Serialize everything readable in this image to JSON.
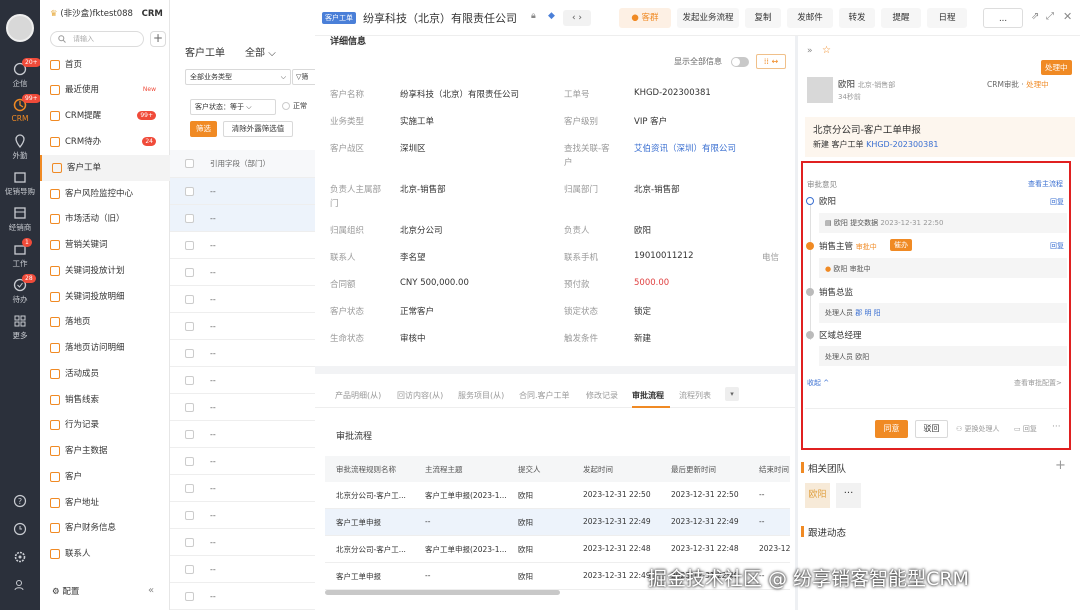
{
  "rail": {
    "items": [
      {
        "icon": "chat-icon",
        "label": "企信",
        "badge": "20+"
      },
      {
        "icon": "crm-icon",
        "label": "CRM",
        "badge": "99+"
      },
      {
        "icon": "location-icon",
        "label": "外勤",
        "badge": ""
      },
      {
        "icon": "box-icon",
        "label": "促销导购",
        "badge": ""
      },
      {
        "icon": "dealer-icon",
        "label": "经销商",
        "badge": ""
      },
      {
        "icon": "work-icon",
        "label": "工作",
        "badge": "1"
      },
      {
        "icon": "todo-icon",
        "label": "待办",
        "badge": "28"
      },
      {
        "icon": "grid-icon",
        "label": "更多",
        "badge": ""
      }
    ]
  },
  "sidebar": {
    "company": "(非沙盒)fktest088",
    "app": "CRM",
    "search_placeholder": "请输入",
    "items": [
      {
        "label": "首页",
        "tag": ""
      },
      {
        "label": "最近使用",
        "tag": "New"
      },
      {
        "label": "CRM提醒",
        "tag": "99+"
      },
      {
        "label": "CRM待办",
        "tag": "24"
      },
      {
        "label": "客户工单",
        "tag": ""
      },
      {
        "label": "客户风险监控中心",
        "tag": ""
      },
      {
        "label": "市场活动（旧）",
        "tag": ""
      },
      {
        "label": "营销关键词",
        "tag": ""
      },
      {
        "label": "关键词投放计划",
        "tag": ""
      },
      {
        "label": "关键词投放明细",
        "tag": ""
      },
      {
        "label": "落地页",
        "tag": ""
      },
      {
        "label": "落地页访问明细",
        "tag": ""
      },
      {
        "label": "活动成员",
        "tag": ""
      },
      {
        "label": "销售线索",
        "tag": ""
      },
      {
        "label": "行为记录",
        "tag": ""
      },
      {
        "label": "客户主数据",
        "tag": ""
      },
      {
        "label": "客户",
        "tag": ""
      },
      {
        "label": "客户地址",
        "tag": ""
      },
      {
        "label": "客户财务信息",
        "tag": ""
      },
      {
        "label": "联系人",
        "tag": ""
      }
    ],
    "config": "配置",
    "collapse": "«"
  },
  "list": {
    "title": "客户工单",
    "scope": "全部",
    "type_select": "全部业务类型",
    "filter_btn": "筛",
    "status_filter": "客户状态：等于",
    "status_option": "正常",
    "btn_filter": "筛选",
    "btn_clear": "清除外露筛选值",
    "column": "引用字段（部门）",
    "rows": [
      "--",
      "--",
      "--",
      "--",
      "--",
      "--",
      "--",
      "--",
      "--",
      "--",
      "--",
      "--",
      "--",
      "--",
      "--",
      "--"
    ]
  },
  "header": {
    "tag": "客户工单",
    "title": "纷享科技（北京）有限责任公司",
    "buttons": [
      "客群",
      "发起业务流程",
      "复制",
      "发邮件",
      "转发",
      "提醒",
      "日程",
      "..."
    ]
  },
  "detail": {
    "section": "详细信息",
    "show_all": "显示全部信息",
    "fields": [
      {
        "l1": "客户名称",
        "v1": "纷享科技（北京）有限责任公司",
        "l2": "工单号",
        "v2": "KHGD-202300381"
      },
      {
        "l1": "业务类型",
        "v1": "实施工单",
        "l2": "客户级别",
        "v2": "VIP 客户"
      },
      {
        "l1": "客户战区",
        "v1": "深圳区",
        "l2": "查找关联-客户",
        "v2": "艾伯资讯（深圳）有限公司"
      },
      {
        "l1": "负责人主属部门",
        "v1": "北京-销售部",
        "l2": "归属部门",
        "v2": "北京-销售部"
      },
      {
        "l1": "归属组织",
        "v1": "北京分公司",
        "l2": "负责人",
        "v2": "欧阳"
      },
      {
        "l1": "联系人",
        "v1": "李名望",
        "l2": "联系手机",
        "v2": "19010011212"
      },
      {
        "l1": "合同额",
        "v1": "CNY 500,000.00",
        "l2": "预付款",
        "v2": "5000.00"
      },
      {
        "l1": "客户状态",
        "v1": "正常客户",
        "l2": "锁定状态",
        "v2": "锁定"
      },
      {
        "l1": "生命状态",
        "v1": "审核中",
        "l2": "触发条件",
        "v2": "新建"
      }
    ],
    "phone_label": "电信",
    "tabs": [
      "产品明细(从)",
      "回访内容(从)",
      "服务项目(从)",
      "合同.客户工单",
      "修改记录",
      "审批流程",
      "流程列表"
    ],
    "active_tab": "审批流程",
    "flow_title": "审批流程",
    "table_headers": [
      "审批流程规则名称",
      "主流程主题",
      "提交人",
      "发起时间",
      "最后更新时间",
      "结束时间"
    ],
    "table_rows": [
      [
        "北京分公司-客户工...",
        "客户工单申报(2023-1...",
        "欧阳",
        "2023-12-31 22:50",
        "2023-12-31 22:50",
        "--"
      ],
      [
        "客户工单申报",
        "--",
        "欧阳",
        "2023-12-31 22:49",
        "2023-12-31 22:49",
        "--"
      ],
      [
        "北京分公司-客户工...",
        "客户工单申报(2023-1...",
        "欧阳",
        "2023-12-31 22:48",
        "2023-12-31 22:48",
        "2023-12"
      ],
      [
        "客户工单申报",
        "--",
        "欧阳",
        "2023-12-31 22:49",
        "2023-12-31 22:49",
        "--"
      ]
    ]
  },
  "approval": {
    "status_badge": "处理中",
    "user": "欧阳",
    "user_dept": "北京-销售部",
    "time_ago": "34秒前",
    "crm_approval": "CRM审批 · ",
    "crm_status": "处理中",
    "card_title": "北京分公司-客户工单申报",
    "card_sub": "新建 客户工单 ",
    "card_link": "KHGD-202300381",
    "opinion": "审批意见",
    "view_flow": "查看主流程",
    "steps": [
      {
        "name": "欧阳",
        "reply": "回复",
        "note_user": "欧阳",
        "note": "提交数据",
        "note_time": "2023-12-31 22:50"
      },
      {
        "name": "销售主管",
        "status": "审批中",
        "urge": "催办",
        "reply": "回复",
        "note_user": "欧阳",
        "note": "审批中"
      },
      {
        "name": "销售总监",
        "handler_label": "处理人员",
        "handler": "郡 明 阳"
      },
      {
        "name": "区域总经理",
        "handler_label": "处理人员",
        "handler": "欧阳"
      }
    ],
    "collapse": "收起 ^",
    "view_config": "查看审批配置>",
    "agree": "同意",
    "reject": "驳回",
    "change_handler": "更换处理人",
    "reply": "回复",
    "more": "···",
    "team_title": "相关团队",
    "team_member": "欧阳",
    "follow_title": "跟进动态"
  },
  "watermark": "掘金技术社区 @ 纷享销客智能型CRM"
}
